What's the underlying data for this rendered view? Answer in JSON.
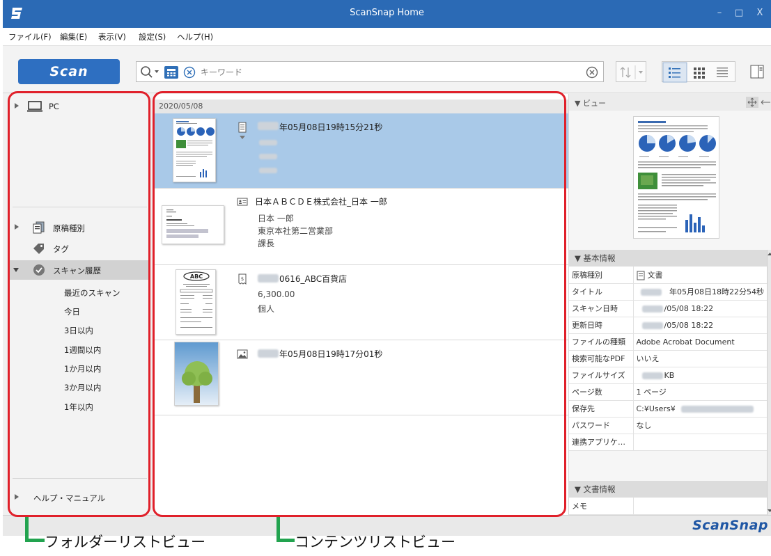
{
  "window": {
    "title": "ScanSnap Home",
    "controls": {
      "minimize": "–",
      "maximize": "□",
      "close": "X"
    }
  },
  "menu": [
    "ファイル(F)",
    "編集(E)",
    "表示(V)",
    "設定(S)",
    "ヘルプ(H)"
  ],
  "toolbar": {
    "scan_label": "Scan",
    "search_placeholder": "キーワード"
  },
  "folder_list": {
    "pc_label": "PC",
    "doc_type_label": "原稿種別",
    "tag_label": "タグ",
    "scan_history_label": "スキャン履歴",
    "history_items": [
      "最近のスキャン",
      "今日",
      "3日以内",
      "1週間以内",
      "1か月以内",
      "3か月以内",
      "1年以内"
    ],
    "help_label": "ヘルプ・マニュアル"
  },
  "content_list": {
    "date_header": "2020/05/08",
    "items": [
      {
        "type": "document-icon",
        "title": "年05月08日19時15分21秒",
        "lines": [],
        "selected": true
      },
      {
        "type": "business-card-icon",
        "title": "日本ＡＢＣＤＥ株式会社_日本 一郎",
        "lines": [
          "日本 一郎",
          "東京本社第二営業部",
          "課長"
        ],
        "selected": false
      },
      {
        "type": "receipt-icon",
        "title": "0616_ABC百貨店",
        "lines": [
          "6,300.00",
          "個人"
        ],
        "selected": false
      },
      {
        "type": "photo-icon",
        "title": "年05月08日19時17分01秒",
        "lines": [],
        "selected": false
      }
    ]
  },
  "right_pane": {
    "view_header": "▼ ビュー",
    "basic_info_header": "▼ 基本情報",
    "properties": [
      {
        "key": "原稿種別",
        "value": "文書"
      },
      {
        "key": "タイトル",
        "value": "年05月08日18時22分54秒"
      },
      {
        "key": "スキャン日時",
        "value": "/05/08 18:22"
      },
      {
        "key": "更新日時",
        "value": "/05/08 18:22"
      },
      {
        "key": "ファイルの種類",
        "value": "Adobe Acrobat Document"
      },
      {
        "key": "検索可能なPDF",
        "value": "いいえ"
      },
      {
        "key": "ファイルサイズ",
        "value": "KB"
      },
      {
        "key": "ページ数",
        "value": "1 ページ"
      },
      {
        "key": "保存先",
        "value": "C:¥Users¥"
      },
      {
        "key": "パスワード",
        "value": "なし"
      },
      {
        "key": "連携アプリケー...",
        "value": ""
      }
    ],
    "doc_info_header": "▼ 文書情報",
    "memo_label": "メモ"
  },
  "status_logo": "ScanSnap",
  "annotations": {
    "folder_list_label": "フォルダーリストビュー",
    "content_list_label": "コンテンツリストビュー"
  },
  "colors": {
    "titlebar": "#2b6ab5",
    "accent": "#2e6fc1",
    "highlight": "#e0202a",
    "callout": "#22a34f",
    "selected_row": "#a9c9e8"
  }
}
